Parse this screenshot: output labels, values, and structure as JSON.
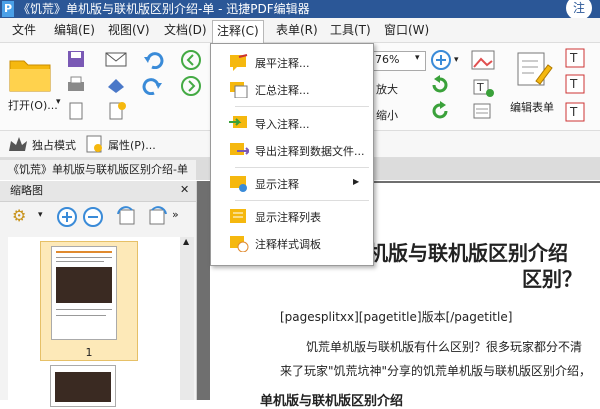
{
  "window": {
    "title": "《饥荒》单机版与联机版区别介绍-单 - 迅捷PDF编辑器",
    "logo": "P",
    "close_glyph": "注"
  },
  "menubar": {
    "items": [
      {
        "label": "文件"
      },
      {
        "label": "编辑(E)"
      },
      {
        "label": "视图(V)"
      },
      {
        "label": "文档(D)"
      },
      {
        "label": "注释(C)"
      },
      {
        "label": "表单(R)"
      },
      {
        "label": "工具(T)"
      },
      {
        "label": "窗口(W)"
      }
    ],
    "active_index": 4
  },
  "ribbon": {
    "open_label": "打开(O)...",
    "zoom_value": "76%",
    "zoom_in_label": "放大",
    "zoom_out_label": "缩小",
    "edit_form_label": "编辑表单"
  },
  "toolrow": {
    "exclusive_mode_label": "独占模式",
    "properties_label": "属性(P)..."
  },
  "doc_tab": {
    "label": "《饥荒》单机版与联机版区别介绍-单"
  },
  "thumbnails": {
    "title": "缩略图",
    "page_number": "1"
  },
  "annotation_menu": {
    "items": [
      {
        "label": "展平注释..."
      },
      {
        "label": "汇总注释..."
      },
      {
        "label": "导入注释..."
      },
      {
        "label": "导出注释到数据文件..."
      },
      {
        "label": "显示注释",
        "submenu_arrow": "▶"
      },
      {
        "label": "显示注释列表"
      },
      {
        "label": "注释样式调板"
      }
    ]
  },
  "document": {
    "heading_line1": "机版与联机版区别介绍",
    "heading_line2": "区别？",
    "pagesplit": "[pagesplitxx][pagetitle]版本[/pagetitle]",
    "para1": "饥荒单机版与联机版有什么区别？很多玩家都分不清",
    "para2": "来了玩家\"饥荒坑神\"分享的饥荒单机版与联机版区别介绍，",
    "para3": "单机版与联机版区别介绍"
  },
  "colors": {
    "titlebar": "#2b5797",
    "accent_yellow": "#f5b80f",
    "thumb_selected": "#fde9b8"
  }
}
